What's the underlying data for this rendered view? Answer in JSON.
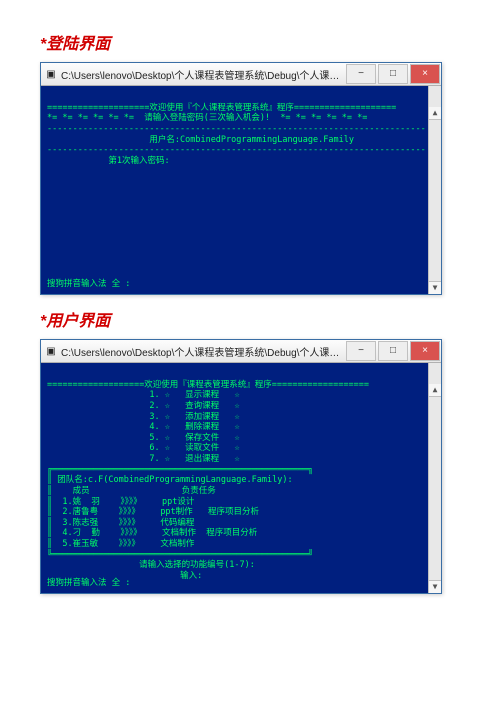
{
  "heading1": "*登陆界面",
  "heading2": "*用户界面",
  "window_title": "C:\\Users\\lenovo\\Desktop\\个人课程表管理系统\\Debug\\个人课表管理系统.exe",
  "btn_min": "−",
  "btn_max": "□",
  "btn_close": "×",
  "sb_up": "▲",
  "sb_down": "▼",
  "ime": "搜狗拼音输入法 全 :",
  "login": {
    "line1": "====================欢迎使用『个人课程表管理系统』程序====================",
    "line2": "*= *= *= *= *= *=  请输入登陆密码(三次输入机会)!  *= *= *= *= *= *=",
    "line_sep1": "--------------------------------------------------------------------------",
    "line_user_label": "用户名:",
    "line_user_value": "CombinedProgrammingLanguage.Family",
    "line_sep2": "--------------------------------------------------------------------------",
    "line_pw": "第1次输入密码:"
  },
  "menu": {
    "line1": "===================欢迎使用『课程表管理系统』程序===================",
    "items": [
      "1. ☆   显示课程   ☆",
      "2. ☆   查询课程   ☆",
      "3. ☆   添加课程   ☆",
      "4. ☆   删除课程   ☆",
      "5. ☆   保存文件   ☆",
      "6. ☆   读取文件   ☆",
      "7. ☆   退出课程   ☆"
    ],
    "box_top": "╔══════════════════════════════════════════════════╗",
    "team_label": "团队名:",
    "team_value": "c.F(CombinedProgrammingLanguage.Family):",
    "members_header_left": "成员",
    "members_header_right": "负责任务",
    "members": [
      [
        "1.姚  羽",
        "ppt设计"
      ],
      [
        "2.唐鲁粤",
        "ppt制作   程序项目分析"
      ],
      [
        "3.陈志强",
        "代码编程"
      ],
      [
        "4.刁  勤",
        "文档制作  程序项目分析"
      ],
      [
        "5.崔玉敏",
        "文档制作"
      ]
    ],
    "box_bot": "╚══════════════════════════════════════════════════╝",
    "prompt1": "请输入选择的功能编号(1-7):",
    "prompt2": "输入:"
  }
}
